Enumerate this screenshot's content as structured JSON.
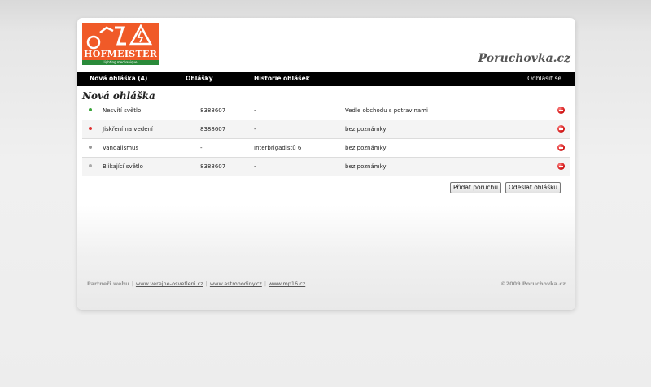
{
  "site": {
    "title": "Poruchovka.cz",
    "logo_word": "HOFMEISTER",
    "logo_tagline": "lighting mechanique"
  },
  "nav": {
    "items": [
      {
        "label": "Nová ohláška (4)"
      },
      {
        "label": "Ohlášky"
      },
      {
        "label": "Historie ohlášek"
      }
    ],
    "logout": "Odhlásit se"
  },
  "section_title": "Nová ohláška",
  "rows": [
    {
      "name": "Nesvítí světlo",
      "phone": "8388607",
      "address": "-",
      "note": "Vedle obchodu s potravinami",
      "status_color": "#3aa53a"
    },
    {
      "name": "Jiskření na vedení",
      "phone": "8388607",
      "address": "-",
      "note": "bez poznámky",
      "status_color": "#e03030"
    },
    {
      "name": "Vandalismus",
      "phone": "-",
      "address": "Interbrigadistů 6",
      "note": "bez poznámky",
      "status_color": "#999999"
    },
    {
      "name": "Blikající světlo",
      "phone": "8388607",
      "address": "-",
      "note": "bez poznámky",
      "status_color": "#aaaaaa"
    }
  ],
  "buttons": {
    "add": "Přidat poruchu",
    "send": "Odeslat ohlášku"
  },
  "footer": {
    "partners_label": "Partneři webu",
    "links": [
      "www.verejne-osvetleni.cz",
      "www.astrohodiny.cz",
      "www.mp16.cz"
    ],
    "copyright": "©2009 Poruchovka.cz"
  }
}
